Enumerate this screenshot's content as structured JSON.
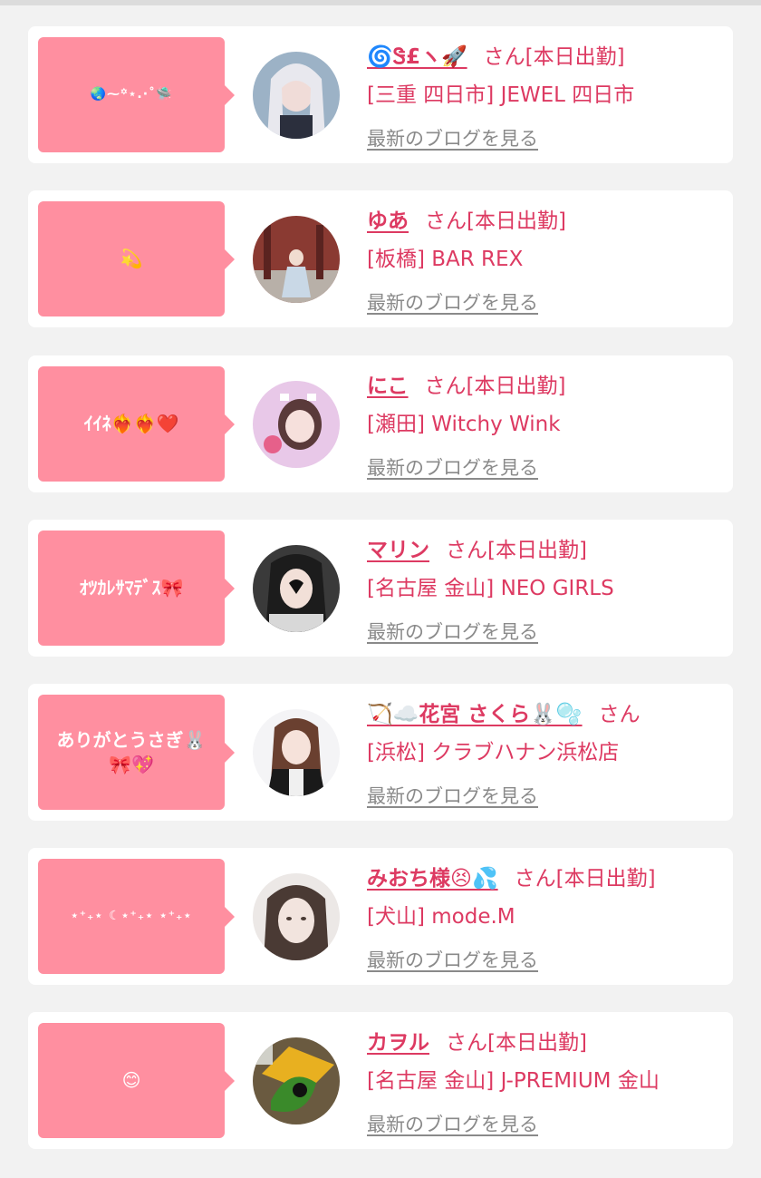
{
  "san_label": "さん",
  "blog_label": "最新のブログを見る",
  "items": [
    {
      "message": "🌏⁓꙳⋆.·˚🛸",
      "name": "🌀Ꮥ£ヽ🚀",
      "status": "[本日出勤]",
      "shop": "[三重 四日市] JEWEL 四日市"
    },
    {
      "message": "💫",
      "name": "ゆあ",
      "status": "[本日出勤]",
      "shop": "[板橋] BAR REX"
    },
    {
      "message": "ｲｲﾈ❤️‍🔥❤️‍🔥❤️",
      "name": "にこ",
      "status": "[本日出勤]",
      "shop": "[瀬田] Witchy Wink"
    },
    {
      "message": "ｵﾂｶﾚｻﾏﾃﾞｽ🎀",
      "name": "マリン",
      "status": "[本日出勤]",
      "shop": "[名古屋 金山] NEO GIRLS"
    },
    {
      "message": "ありがとうさぎ🐰\n🎀💖",
      "name": "🏹☁️花宮 さくら🐰🫧",
      "status": "",
      "shop": "[浜松] クラブハナン浜松店"
    },
    {
      "message": "⋆⁺₊⋆ ☾⋆⁺₊⋆ ⋆⁺₊⋆",
      "name": "みおち様😣💦",
      "status": "[本日出勤]",
      "shop": "[犬山] mode.M"
    },
    {
      "message": "😊",
      "name": "カヲル",
      "status": "[本日出勤]",
      "shop": "[名古屋 金山] J-PREMIUM 金山"
    }
  ]
}
